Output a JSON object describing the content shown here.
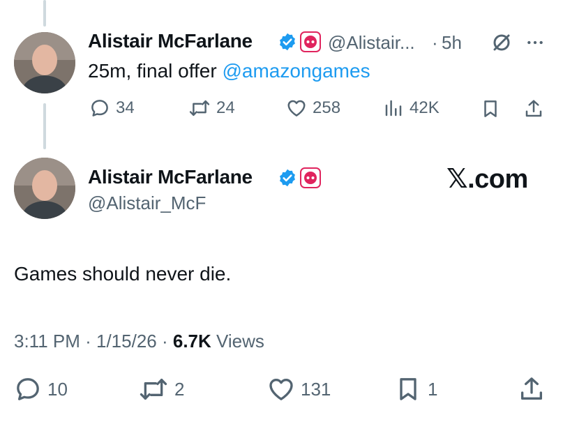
{
  "reply": {
    "author_name": "Alistair McFarlane",
    "handle": "@Alistair...",
    "separator": "·",
    "time_ago": "5h",
    "text": "25m, final offer ",
    "mention": "@amazongames",
    "actions": {
      "replies": "34",
      "reposts": "24",
      "likes": "258",
      "views": "42K"
    }
  },
  "main": {
    "author_name": "Alistair McFarlane",
    "handle": "@Alistair_McF",
    "watermark": "𝕏.com",
    "text": "Games should never die.",
    "timestamp": "3:11 PM · 1/15/26 · ",
    "views_count": "6.7K",
    "views_label": " Views",
    "actions": {
      "replies": "10",
      "reposts": "2",
      "likes": "131",
      "bookmarks": "1"
    }
  },
  "colors": {
    "accent": "#1d9bf0",
    "text_secondary": "#536471",
    "badge_red": "#e0245e"
  }
}
